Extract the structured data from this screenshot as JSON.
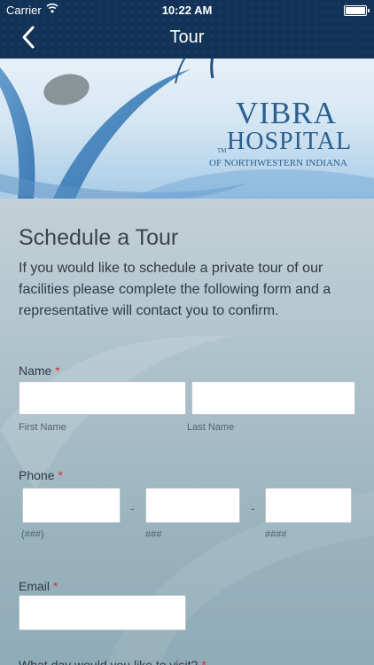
{
  "status_bar": {
    "carrier": "Carrier",
    "time": "10:22 AM"
  },
  "nav": {
    "title": "Tour"
  },
  "brand": {
    "line1": "VIBRA",
    "line2": "HOSPITAL",
    "line3": "OF NORTHWESTERN INDIANA",
    "tm": "TM"
  },
  "form": {
    "title": "Schedule a Tour",
    "intro": "If you would like to schedule a private tour of our facilities please complete the following form and a representative will contact you to confirm.",
    "required_mark": "*",
    "name": {
      "label": "Name",
      "first_sub": "First Name",
      "last_sub": "Last Name"
    },
    "phone": {
      "label": "Phone",
      "sep": "-",
      "area_sub": "(###)",
      "prefix_sub": "###",
      "line_sub": "####"
    },
    "email": {
      "label": "Email"
    },
    "visit": {
      "label": "What day would you like to visit?"
    }
  },
  "colors": {
    "nav_bg": "#133257",
    "required": "#d9342b",
    "brand_blue": "#2b5f8f"
  },
  "icons": [
    "wifi-icon",
    "battery-icon",
    "back-chevron-icon"
  ]
}
